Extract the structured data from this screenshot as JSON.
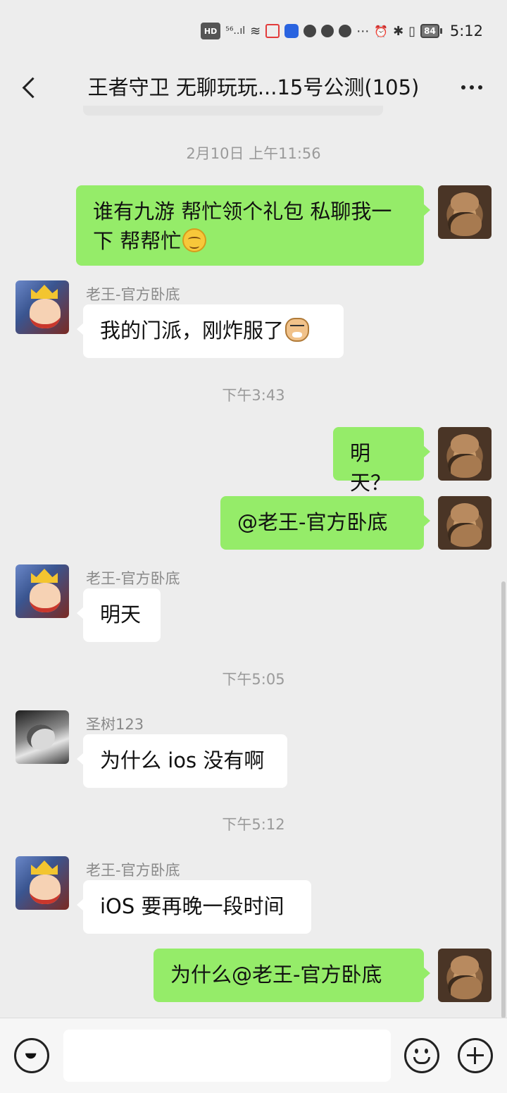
{
  "status_bar": {
    "hd": "HD",
    "signal": "⁵⁶..ıl",
    "wifi": "≋",
    "extra": "⋯",
    "alarm": "⏰",
    "bluetooth": "✱",
    "vibrate": "▯",
    "battery": "84",
    "time": "5:12"
  },
  "header": {
    "title": "王者守卫 无聊玩玩...15号公测(105)"
  },
  "messages": [
    {
      "type": "timestamp",
      "text": "2月10日 上午11:56"
    },
    {
      "type": "out",
      "text": "谁有九游 帮忙领个礼包 私聊我一下 帮帮忙",
      "emoji": "smile-emoji"
    },
    {
      "type": "in",
      "sender": "老王-官方卧底",
      "text": "我的门派，刚炸服了",
      "emoji": "doge-emoji"
    },
    {
      "type": "timestamp",
      "text": "下午3:43"
    },
    {
      "type": "out",
      "text": "明天？"
    },
    {
      "type": "out",
      "text": "@老王-官方卧底"
    },
    {
      "type": "in",
      "sender": "老王-官方卧底",
      "text": "明天"
    },
    {
      "type": "timestamp",
      "text": "下午5:05"
    },
    {
      "type": "in",
      "sender": "圣树123",
      "text": "为什么 ios 没有啊"
    },
    {
      "type": "timestamp",
      "text": "下午5:12"
    },
    {
      "type": "in",
      "sender": "老王-官方卧底",
      "text": "iOS 要再晚一段时间"
    },
    {
      "type": "out",
      "text": "为什么@老王-官方卧底"
    }
  ],
  "input": {
    "value": "",
    "placeholder": ""
  },
  "icons": {
    "back": "back-chevron-icon",
    "more": "more-dots-icon",
    "voice": "voice-icon",
    "emoji": "emoji-icon",
    "plus": "plus-icon"
  },
  "colors": {
    "background": "#ededed",
    "outgoing_bubble": "#95ec69",
    "incoming_bubble": "#ffffff",
    "timestamp_text": "#9a9a9a"
  }
}
